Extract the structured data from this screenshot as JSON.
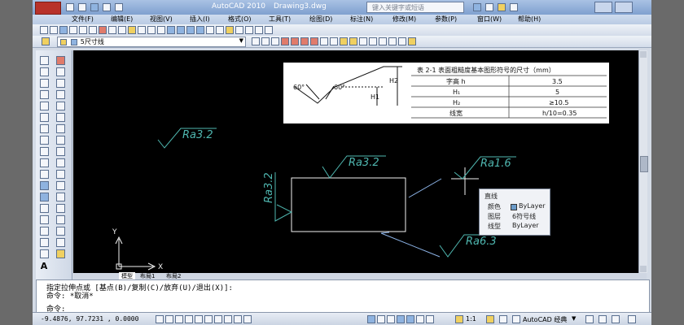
{
  "title": {
    "app_name": "AutoCAD 2010",
    "file_name": "Drawing3.dwg",
    "search_placeholder": "键入关键字或短语"
  },
  "menu": [
    "文件(F)",
    "编辑(E)",
    "视图(V)",
    "插入(I)",
    "格式(O)",
    "工具(T)",
    "绘图(D)",
    "标注(N)",
    "修改(M)",
    "参数(P)",
    "窗口(W)",
    "帮助(H)"
  ],
  "layer_toolbar": {
    "layer_value": "5尺寸线"
  },
  "drawing": {
    "table_title": "表 2-1  表面粗糙度基本图形符号的尺寸（mm）",
    "table_rows": [
      [
        "字高 h",
        "3.5"
      ],
      [
        "H₁",
        "5"
      ],
      [
        "H₂",
        "≥10.5"
      ],
      [
        "线宽",
        "h/10=0.35"
      ]
    ],
    "symbol_labels": {
      "angle_left": "60°",
      "angle_right": "60°",
      "h1": "H1",
      "h2": "H2"
    },
    "roughness_labels": [
      "Ra3.2",
      "Ra3.2",
      "Ra3.2",
      "Ra1.6",
      "Ra6.3"
    ],
    "ucs": {
      "x": "X",
      "y": "Y"
    }
  },
  "tooltip": {
    "title": "直线",
    "rows": [
      {
        "label": "颜色",
        "value": "ByLayer"
      },
      {
        "label": "图层",
        "value": "6符号线"
      },
      {
        "label": "线型",
        "value": "ByLayer"
      }
    ]
  },
  "layout_tabs": [
    "模型",
    "布局1",
    "布局2"
  ],
  "command": {
    "line1": "指定拉伸点或 [基点(B)/复制(C)/放弃(U)/退出(X)]:",
    "line2": "命令: *取消*",
    "line3": "命令:"
  },
  "status": {
    "coords": "-9.4876,  97.7231 , 0.0000",
    "scale": "1:1",
    "workspace": "AutoCAD 经典"
  },
  "colors": {
    "canvas": "#000000",
    "geometry": "#f2f2f2",
    "annotation": "#4fb7b0",
    "leader": "#8db4e8"
  }
}
